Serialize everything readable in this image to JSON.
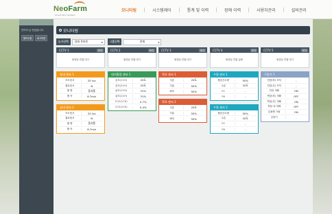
{
  "brand": {
    "logo_main": "Ne",
    "logo_accent": "oFarm",
    "logo_sub": "Smart Farm System"
  },
  "nav": [
    "모니터링",
    "시스템제어",
    "통계 및 이력",
    "장애 이력",
    "사용자관리",
    "설비관리"
  ],
  "sidebar": {
    "user_text": "관리자 님 반갑습니다.",
    "btn_info": "정보수정",
    "btn_logout": "로그아웃"
  },
  "page_title": "모니터링",
  "filters": {
    "farm_label": "농가선택",
    "farm_value": "강태 토마토",
    "group_label": "그룹선택",
    "group_value": "전체"
  },
  "cctv": [
    {
      "name": "CCTV 1",
      "view": "보기",
      "status": "동영상 연결 대기"
    },
    {
      "name": "CCTV 2",
      "view": "보기",
      "status": "동영상 연결 대기"
    },
    {
      "name": "CCTV 3",
      "view": "보기",
      "status": "동영상 연결 대기"
    },
    {
      "name": "CCTV 4",
      "view": "보기",
      "status": "동영상 연결 실패"
    },
    {
      "name": "CCTV 5",
      "view": "보기",
      "status": "동영상 연결 대기"
    }
  ],
  "columns": [
    [
      {
        "title": "실내 센서 1",
        "color": "#f39a1c",
        "rows": [
          [
            "조도센서",
            "20 lux"
          ],
          [
            "결로센서",
            "N"
          ],
          [
            "풍 향",
            "동서풍"
          ],
          [
            "풍 속",
            "8.7m/s"
          ]
        ]
      },
      {
        "title": "실내 센서 2",
        "color": "#f39a1c",
        "rows": [
          [
            "조도센서",
            "20 lux"
          ],
          [
            "결로센서",
            "N"
          ],
          [
            "풍 향",
            "동서풍"
          ],
          [
            "풍 속",
            "8.7m/s"
          ]
        ]
      }
    ],
    [
      {
        "title": "대기환경 센서 1",
        "color": "#3a9a58",
        "rows": [
          [
            "온도(1CH)",
            "20도"
          ],
          [
            "온도(2CH)",
            "20도"
          ],
          [
            "습도(1CH)",
            "31%"
          ],
          [
            "습도(2CH)",
            "31%"
          ],
          [
            "CO2(1CH)",
            "0.7%"
          ],
          [
            "CO2(2CH)",
            "0.4%"
          ]
        ]
      }
    ],
    [
      {
        "title": "육묘 센서 1",
        "color": "#dc5c36",
        "rows": [
          [
            "지온",
            "20도"
          ],
          [
            "지습",
            "50%"
          ],
          [
            "배지",
            "50%"
          ]
        ]
      },
      {
        "title": "육묘 센서 2",
        "color": "#dc5c36",
        "rows": [
          [
            "지온",
            "20도"
          ],
          [
            "지습",
            "50%"
          ],
          [
            "배지",
            "50%"
          ]
        ]
      }
    ],
    [
      {
        "title": "수질 센서 1",
        "color": "#1fa7bf",
        "rows": [
          [
            "용존산소량",
            "50%"
          ],
          [
            "수온",
            "20도"
          ],
          [
            "EC",
            "-"
          ],
          [
            "PH",
            "-"
          ]
        ]
      },
      {
        "title": "수질 센서 2",
        "color": "#1fa7bf",
        "rows": [
          [
            "용존산소량",
            "50%"
          ],
          [
            "수온",
            "20도"
          ],
          [
            "EC",
            "-"
          ],
          [
            "PH",
            "-"
          ]
        ]
      }
    ],
    [
      {
        "title": "구동기 1",
        "color": "#8aa3c6",
        "rows": [
          [
            "천창(좌) 조작",
            "-"
          ],
          [
            "천창(우) 조작",
            "-"
          ],
          [
            "천장 개폐",
            "ON"
          ],
          [
            "측창(좌) 개폐",
            "OFF"
          ],
          [
            "측창(우) 개폐",
            "ON"
          ],
          [
            "측창 내 개폐",
            "OFF"
          ],
          [
            "유동팬 가동",
            "ON"
          ],
          [
            "난방기",
            "-"
          ]
        ]
      }
    ]
  ]
}
